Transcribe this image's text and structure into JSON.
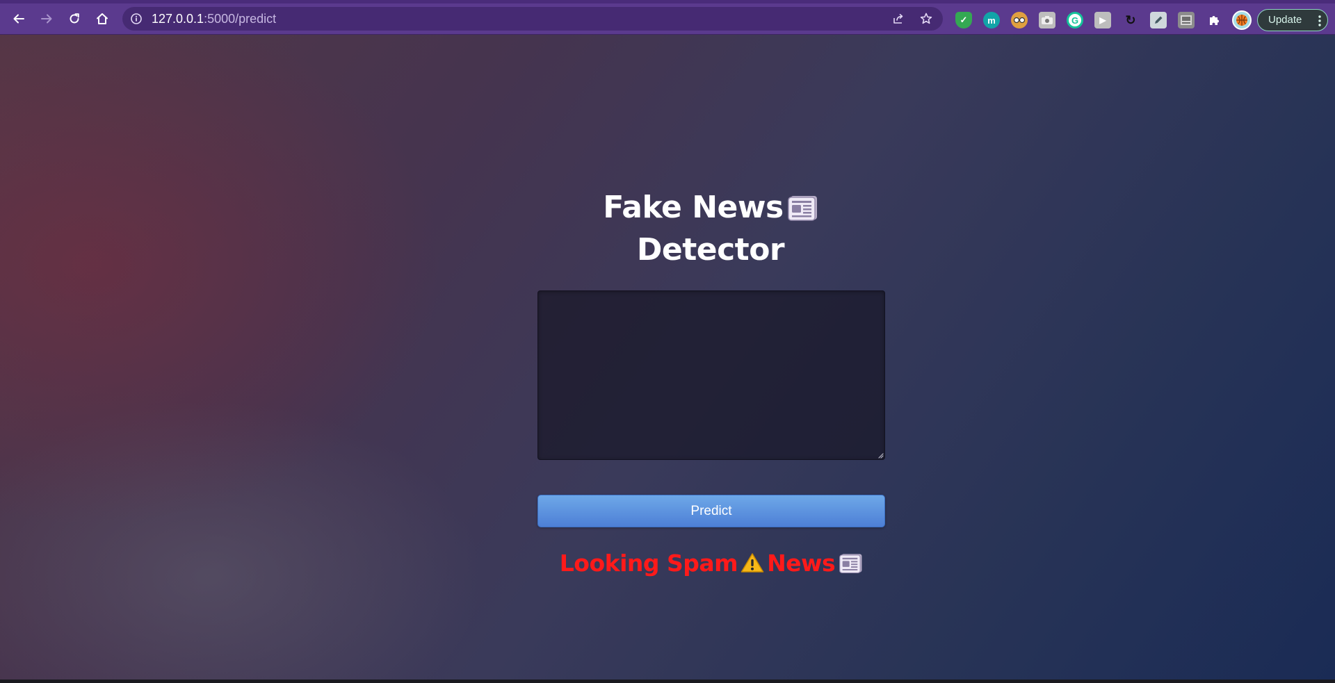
{
  "browser": {
    "url_host": "127.0.0.1",
    "url_path": ":5000/predict",
    "update_label": "Update",
    "extensions": [
      {
        "name": "shield-check-extension",
        "color": "#34a853",
        "glyph": "✓"
      },
      {
        "name": "m-extension",
        "color": "#12a4a8",
        "glyph": "m"
      },
      {
        "name": "spy-extension",
        "color": "#e0a040",
        "glyph": ""
      },
      {
        "name": "camera-extension",
        "color": "#cfcfcf",
        "glyph": ""
      },
      {
        "name": "grammarly-extension",
        "color": "#15c39a",
        "glyph": "G"
      },
      {
        "name": "play-extension",
        "color": "#bdbdbd",
        "glyph": "▶"
      },
      {
        "name": "sync-extension",
        "color": "#222222",
        "glyph": "↻"
      },
      {
        "name": "pen-extension",
        "color": "#cfd8dc",
        "glyph": ""
      },
      {
        "name": "thumbnail-extension",
        "color": "#9e9e9e",
        "glyph": ""
      },
      {
        "name": "puzzle-extension",
        "color": "#ffffff",
        "glyph": ""
      },
      {
        "name": "profile-avatar",
        "color": "#f47b20",
        "glyph": ""
      }
    ]
  },
  "page": {
    "title_line1": "Fake News",
    "title_line2": "Detector",
    "textarea_value": "",
    "predict_label": "Predict",
    "result_part1": "Looking Spam",
    "result_part2": "News",
    "result_color": "#ff1a1a",
    "icons": [
      "newspaper-icon",
      "warning-icon"
    ]
  }
}
